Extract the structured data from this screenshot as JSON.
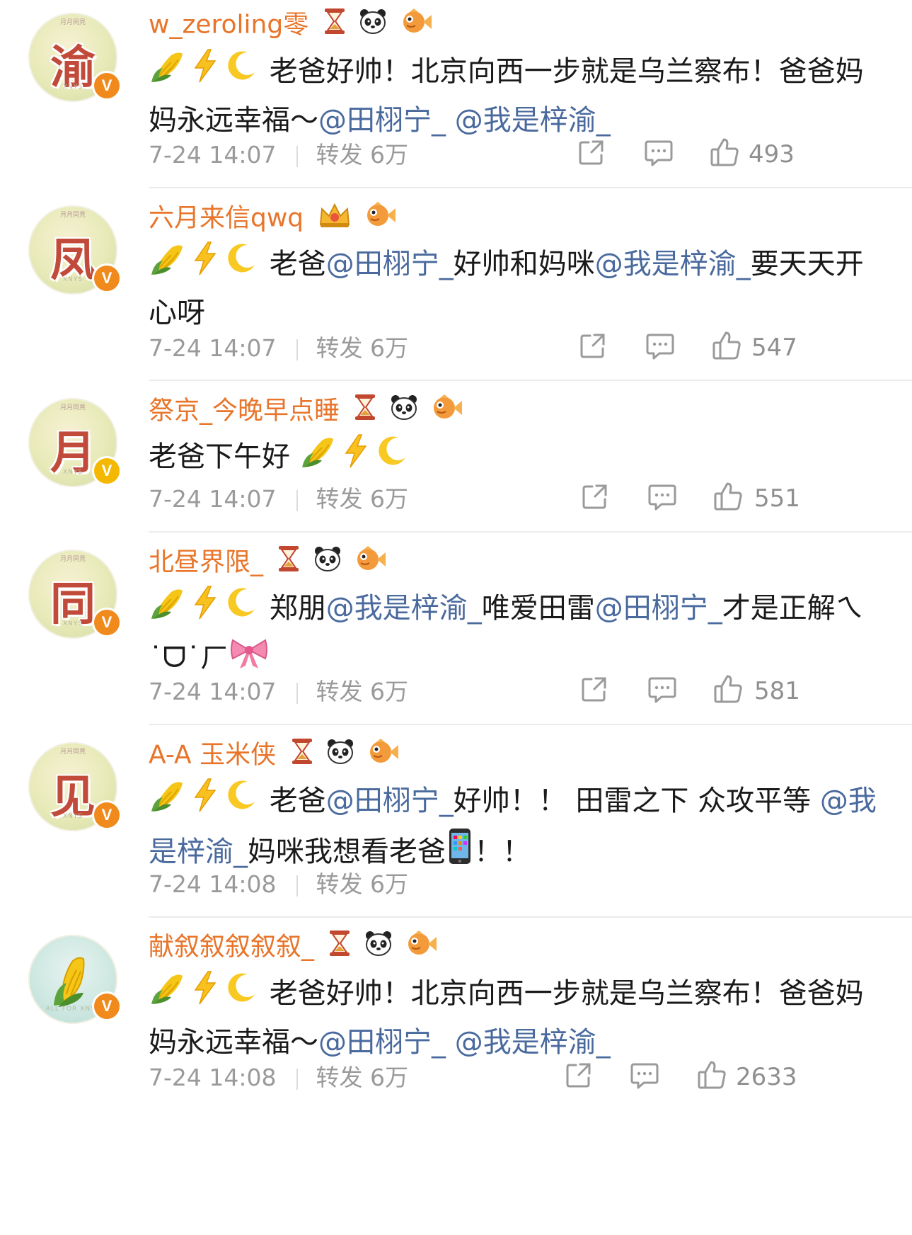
{
  "comments": [
    {
      "avatar_char": "渝",
      "username": "w_zeroling零",
      "badge_icons": [
        "hourglass-icon",
        "panda-icon",
        "fish-icon"
      ],
      "prefix_emojis": [
        "corn-emoji",
        "lightning-emoji",
        "moon-emoji"
      ],
      "text_parts": [
        "老爸好帅！北京向西一步就是乌兰察布！爸爸妈妈永远幸福～",
        "@田栩宁_",
        " ",
        "@我是梓渝_"
      ],
      "time": "7-24 14:07",
      "repost_label": "转发 6万",
      "likes": "493",
      "verified": "V"
    },
    {
      "avatar_char": "凤",
      "username": "六月来信qwq",
      "badge_icons": [
        "crown-icon",
        "fish-icon"
      ],
      "prefix_emojis": [
        "corn-emoji",
        "lightning-emoji",
        "moon-emoji"
      ],
      "text_parts": [
        "老爸",
        "@田栩宁_",
        "好帅和妈咪",
        "@我是梓渝_",
        "要天天开心呀"
      ],
      "time": "7-24 14:07",
      "repost_label": "转发 6万",
      "likes": "547",
      "verified": "V"
    },
    {
      "avatar_char": "月",
      "username": "祭京_今晚早点睡",
      "badge_icons": [
        "hourglass-icon",
        "panda-icon",
        "fish-icon"
      ],
      "prefix_emojis": [],
      "text_parts": [
        "老爸下午好"
      ],
      "suffix_emojis": [
        "corn-emoji",
        "lightning-emoji",
        "moon-emoji"
      ],
      "time": "7-24 14:07",
      "repost_label": "转发 6万",
      "likes": "551",
      "verified": "V"
    },
    {
      "avatar_char": "同",
      "username": "北昼界限_",
      "badge_icons": [
        "hourglass-icon",
        "panda-icon",
        "fish-icon"
      ],
      "prefix_emojis": [
        "corn-emoji",
        "lightning-emoji",
        "moon-emoji"
      ],
      "text_parts": [
        "郑朋",
        "@我是梓渝_",
        "唯爱田雷",
        "@田栩宁_",
        "才是正解",
        "ㄟ˙ᗜ˙ㄏ"
      ],
      "suffix_emojis": [
        "bow-emoji"
      ],
      "time": "7-24 14:07",
      "repost_label": "转发 6万",
      "likes": "581",
      "verified": "V"
    },
    {
      "avatar_char": "见",
      "username": "A-A 玉米侠",
      "badge_icons": [
        "hourglass-icon",
        "panda-icon",
        "fish-icon"
      ],
      "prefix_emojis": [
        "corn-emoji",
        "lightning-emoji",
        "moon-emoji"
      ],
      "text_parts": [
        "老爸",
        "@田栩宁_",
        "好帅！！ 田雷之下 众攻平等 ",
        "@我是梓渝_",
        "妈咪我想看老爸",
        "！！"
      ],
      "time": "7-24 14:08",
      "repost_label": "转发 6万",
      "likes": "",
      "verified": "V"
    },
    {
      "avatar_char": "",
      "username": "献叙叙叙叙叙_",
      "badge_icons": [
        "hourglass-icon",
        "panda-icon",
        "fish-icon"
      ],
      "prefix_emojis": [
        "corn-emoji",
        "lightning-emoji",
        "moon-emoji"
      ],
      "text_parts": [
        "老爸好帅！北京向西一步就是乌兰察布！爸爸妈妈永远幸福～",
        "@田栩宁_",
        " ",
        "@我是梓渝_"
      ],
      "time": "7-24 14:08",
      "repost_label": "转发 6万",
      "likes": "2633",
      "verified": "V"
    }
  ],
  "colors": {
    "username": "#e8752a",
    "mention": "#4a6a9e",
    "meta": "#9a9a9a",
    "badge": "#f08a1d"
  }
}
